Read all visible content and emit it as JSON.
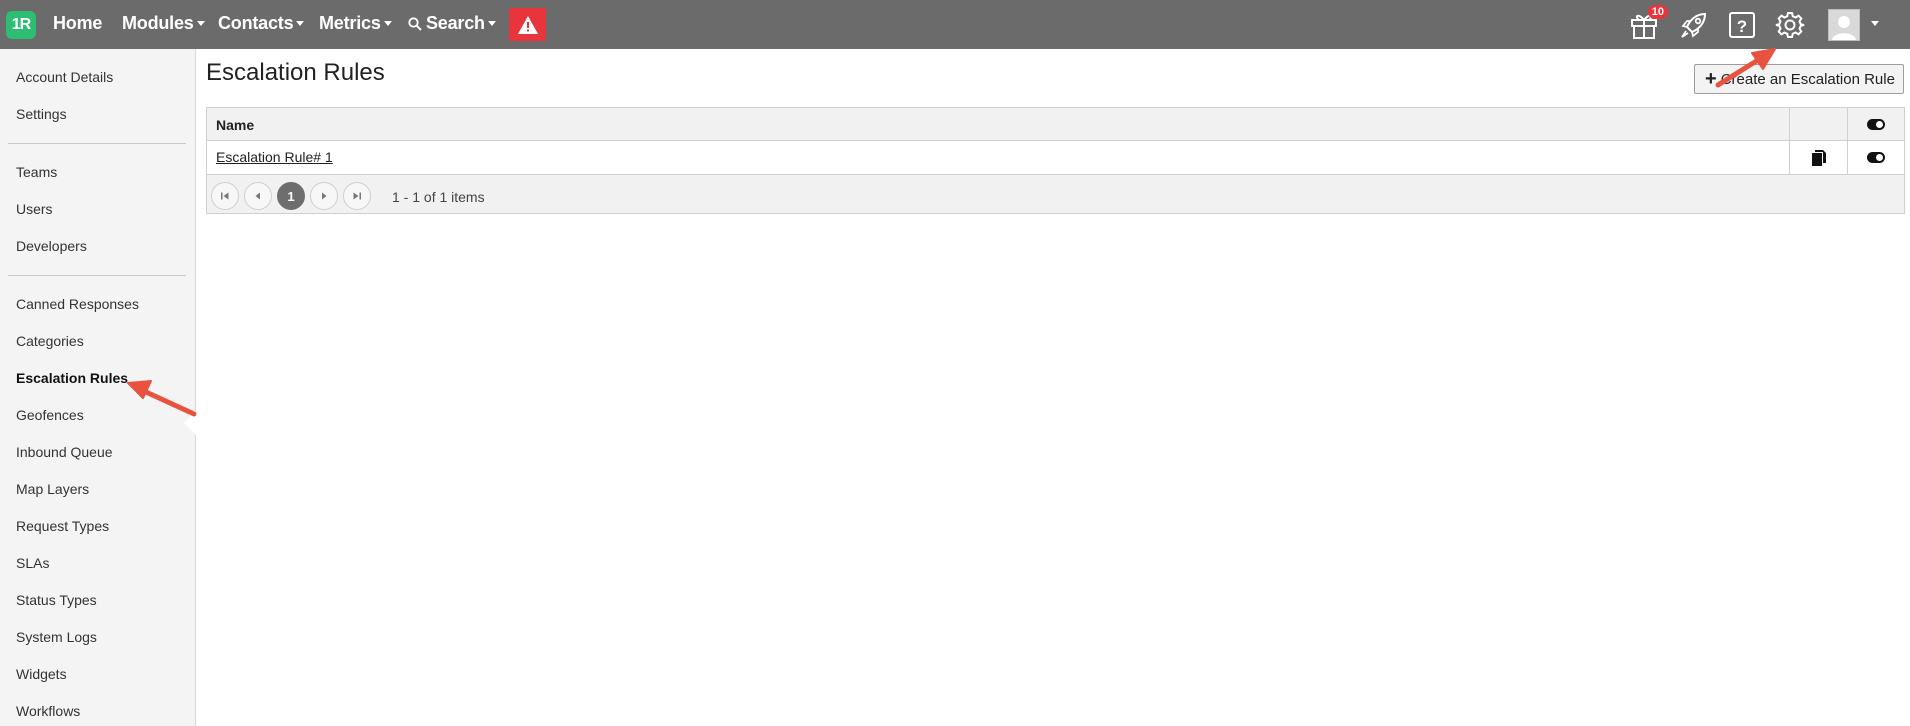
{
  "topbar": {
    "logo_text": "1R",
    "nav": [
      {
        "label": "Home",
        "has_caret": false
      },
      {
        "label": "Modules",
        "has_caret": true
      },
      {
        "label": "Contacts",
        "has_caret": true
      },
      {
        "label": "Metrics",
        "has_caret": true
      },
      {
        "label": "Search",
        "has_caret": true
      }
    ],
    "gift_badge": "10",
    "icons": [
      "alert-icon",
      "gift-icon",
      "rocket-icon",
      "help-icon",
      "gear-icon",
      "avatar-icon"
    ],
    "bar_color": "#6b6b6b",
    "alert_color": "#e8353b",
    "logo_color": "#2dbd73"
  },
  "sidebar": {
    "items": [
      {
        "label": "Account Details"
      },
      {
        "label": "Settings"
      },
      {
        "label": "Teams"
      },
      {
        "label": "Users"
      },
      {
        "label": "Developers"
      },
      {
        "label": "Canned Responses"
      },
      {
        "label": "Categories"
      },
      {
        "label": "Escalation Rules",
        "active": true
      },
      {
        "label": "Geofences"
      },
      {
        "label": "Inbound Queue"
      },
      {
        "label": "Map Layers"
      },
      {
        "label": "Request Types"
      },
      {
        "label": "SLAs"
      },
      {
        "label": "Status Types"
      },
      {
        "label": "System Logs"
      },
      {
        "label": "Widgets"
      },
      {
        "label": "Workflows"
      }
    ]
  },
  "main": {
    "title": "Escalation Rules",
    "create_button": "Create an Escalation Rule",
    "grid": {
      "column_name": "Name",
      "rows": [
        {
          "name": "Escalation Rule# 1",
          "enabled": true
        }
      ],
      "pager": {
        "current_page": "1",
        "info": "1 - 1 of 1 items"
      }
    }
  },
  "annotation_color": "#e8533f"
}
